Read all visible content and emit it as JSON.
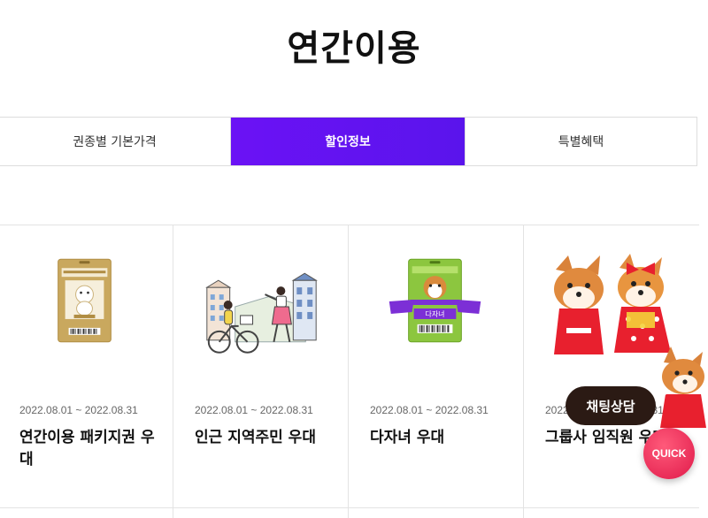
{
  "page": {
    "title": "연간이용"
  },
  "tabs": [
    {
      "label": "권종별 기본가격",
      "active": false
    },
    {
      "label": "할인정보",
      "active": true
    },
    {
      "label": "특별혜택",
      "active": false
    }
  ],
  "cards": [
    {
      "date": "2022.08.01 ~ 2022.08.31",
      "title": "연간이용 패키지권 우대",
      "image": "package-pass-card-image"
    },
    {
      "date": "2022.08.01 ~ 2022.08.31",
      "title": "인근 지역주민 우대",
      "image": "local-residents-illustration"
    },
    {
      "date": "2022.08.01 ~ 2022.08.31",
      "title": "다자녀 우대",
      "image": "multi-child-card-image"
    },
    {
      "date": "2022.08.01 ~ 2022.08.31",
      "title": "그룹사 임직원 우대",
      "image": "mascots-image"
    }
  ],
  "floating": {
    "chat_label": "채팅상담",
    "quick_label": "QUICK"
  },
  "colors": {
    "active_tab": "#6b12f5",
    "quick": "#e01a4a",
    "chat": "#2b1a14"
  }
}
